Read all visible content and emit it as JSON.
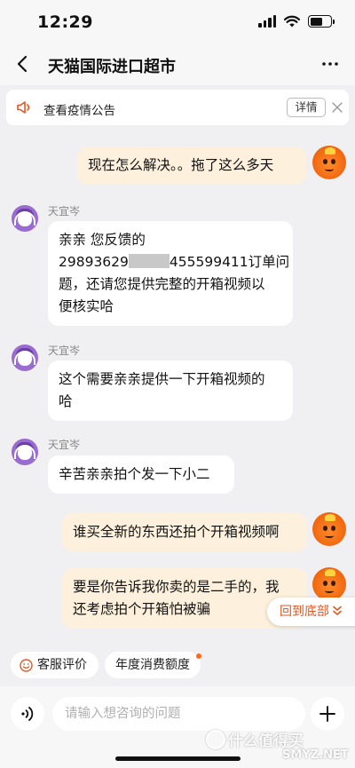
{
  "status_bar": {
    "time": "12:29"
  },
  "header": {
    "title": "天猫国际进口超市"
  },
  "notice": {
    "text": "查看疫情公告",
    "detail_label": "详情"
  },
  "messages": {
    "m1": {
      "lines": [
        "现在怎么解决。。拖了这么多天"
      ]
    },
    "m2": {
      "sender": "天宜岑",
      "line1": "亲亲 您反馈的",
      "line2_prefix": "29893629",
      "line2_suffix": "455599411订单问",
      "line3": "题，还请您提供完整的开箱视频以",
      "line4": "便核实哈"
    },
    "m3": {
      "sender": "天宜岑",
      "lines": [
        "这个需要亲亲提供一下开箱视频的",
        "哈"
      ]
    },
    "m4": {
      "sender": "天宜岑",
      "lines": [
        "辛苦亲亲拍个发一下小二"
      ]
    },
    "m5": {
      "lines": [
        "谁买全新的东西还拍个开箱视频啊"
      ]
    },
    "m6": {
      "lines": [
        "要是你告诉我你卖的是二手的，我",
        "还考虑拍个开箱怕被骗"
      ]
    }
  },
  "jump_to_bottom": {
    "label": "回到底部"
  },
  "quick_actions": {
    "service_rating": "客服评价",
    "annual_quota": "年度消费额度"
  },
  "composer": {
    "placeholder": "请输入想咨询的问题"
  },
  "watermark": {
    "text": "什么值得买",
    "site": "SMYZ.NET"
  },
  "colors": {
    "accent": "#e5571e",
    "outgoing_bubble": "#fdf1dd",
    "agent_avatar": "#9a6ccf"
  }
}
